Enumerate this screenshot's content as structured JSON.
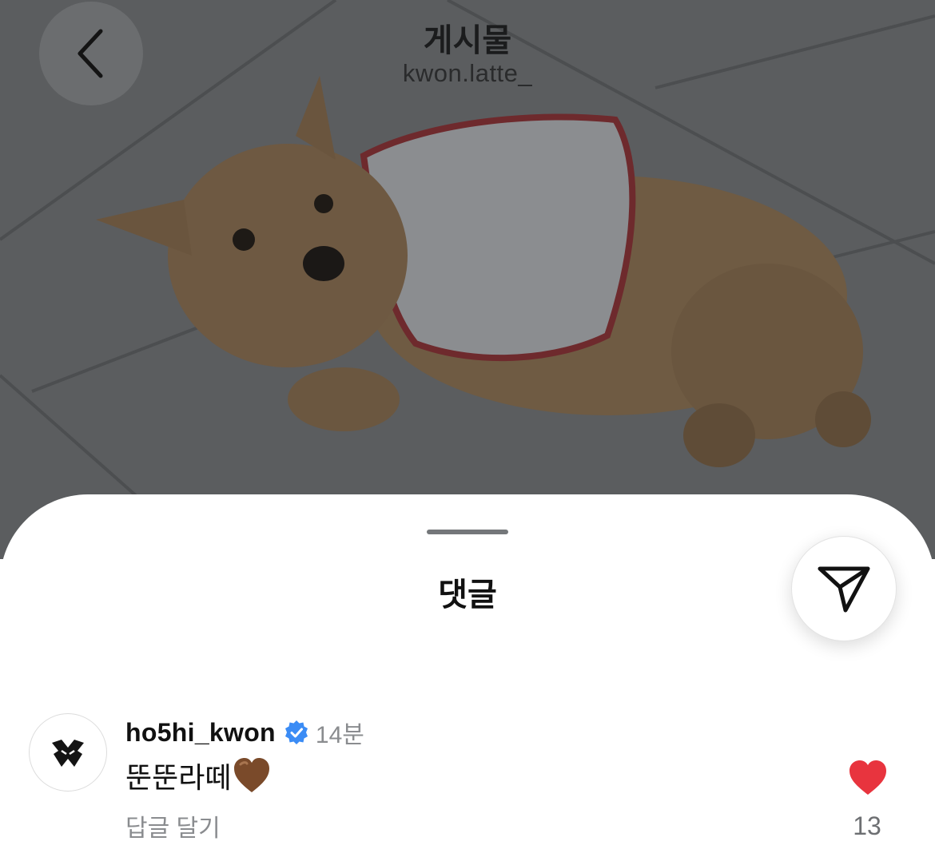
{
  "header": {
    "title": "게시물",
    "subtitle": "kwon.latte_"
  },
  "sheet": {
    "title": "댓글"
  },
  "comment": {
    "username": "ho5hi_kwon",
    "time": "14분",
    "text": "뚠뚠라떼",
    "emoji": "brown-heart-emoji",
    "reply_label": "답글 달기",
    "like_count": "13",
    "liked": true
  },
  "colors": {
    "like_red": "#e8343e",
    "verified_blue": "#3b8cf5",
    "backdrop": "#585a5c"
  },
  "icons": [
    "back-chevron-icon",
    "send-icon",
    "verified-badge-icon",
    "heart-icon",
    "avatar-logo-icon"
  ]
}
